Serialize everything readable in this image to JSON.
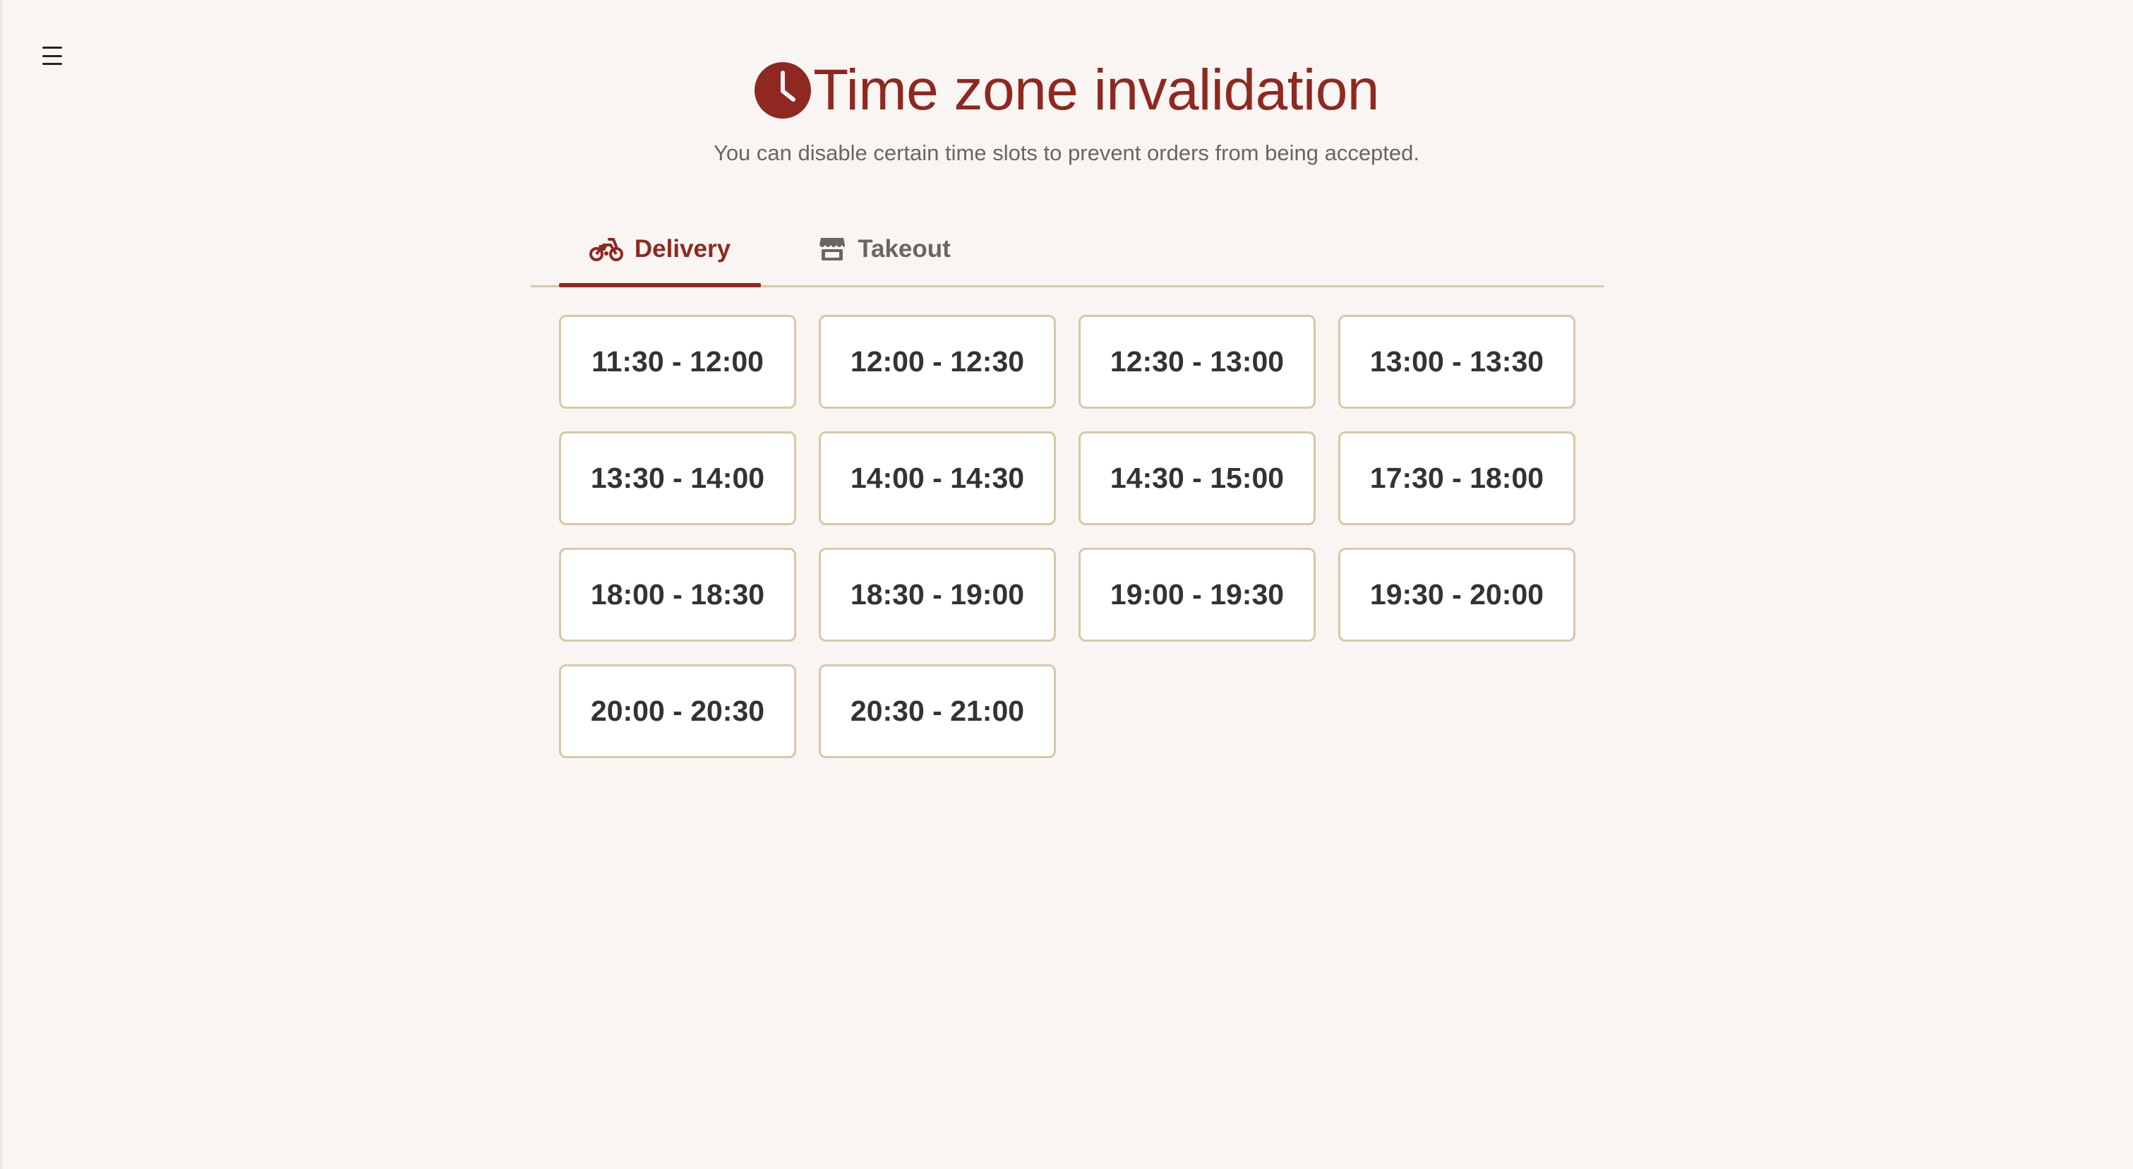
{
  "menu": {
    "icon": "hamburger-menu-icon"
  },
  "header": {
    "icon": "clock-icon",
    "title": "Time zone invalidation",
    "subtitle": "You can disable certain time slots to prevent orders from being accepted."
  },
  "tabs": [
    {
      "label": "Delivery",
      "icon": "motorcycle-icon",
      "active": true
    },
    {
      "label": "Takeout",
      "icon": "store-icon",
      "active": false
    }
  ],
  "time_slots": [
    "11:30 - 12:00",
    "12:00 - 12:30",
    "12:30 - 13:00",
    "13:00 - 13:30",
    "13:30 - 14:00",
    "14:00 - 14:30",
    "14:30 - 15:00",
    "17:30 - 18:00",
    "18:00 - 18:30",
    "18:30 - 19:00",
    "19:00 - 19:30",
    "19:30 - 20:00",
    "20:00 - 20:30",
    "20:30 - 21:00"
  ],
  "colors": {
    "accent": "#8f2820",
    "background": "#f9f5f2",
    "border": "#d7c8a8",
    "muted_text": "#6a6563"
  }
}
